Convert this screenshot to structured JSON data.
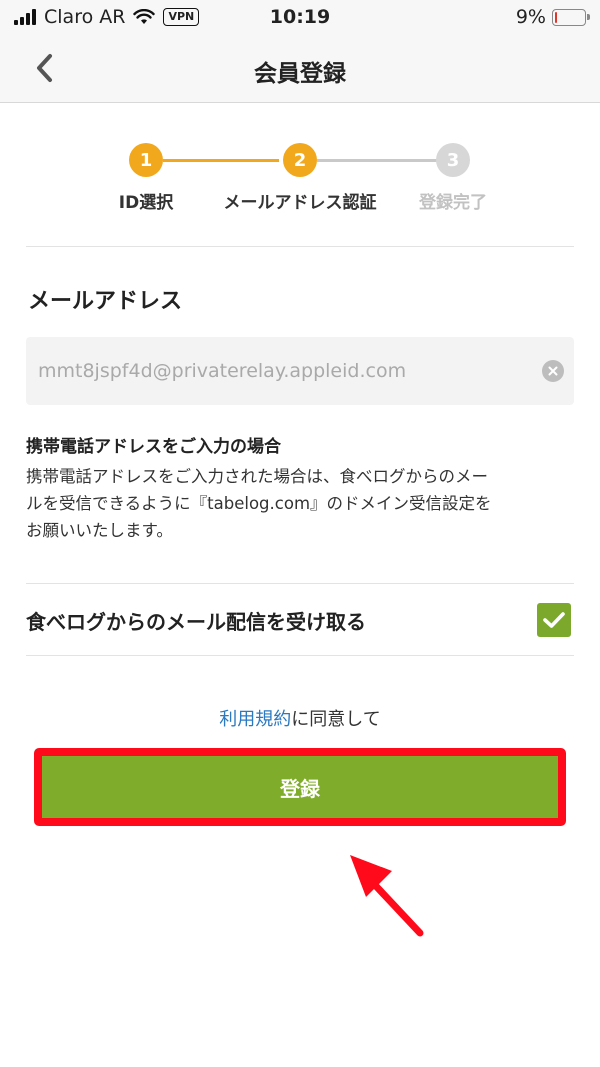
{
  "status_bar": {
    "carrier": "Claro AR",
    "vpn": "VPN",
    "time": "10:19",
    "battery_text": "9%",
    "battery_level": 0.09
  },
  "nav": {
    "title": "会員登録"
  },
  "stepper": {
    "steps": [
      {
        "number": "1",
        "label": "ID選択",
        "state": "done"
      },
      {
        "number": "2",
        "label": "メールアドレス認証",
        "state": "current"
      },
      {
        "number": "3",
        "label": "登録完了",
        "state": "pending"
      }
    ]
  },
  "email": {
    "label": "メールアドレス",
    "value": "mmt8jspf4d@privaterelay.appleid.com"
  },
  "mobile_note": {
    "title": "携帯電話アドレスをご入力の場合",
    "lines": [
      "携帯電話アドレスをご入力された場合は、食べログからのメー",
      "ルを受信できるように『tabelog.com』のドメイン受信設定を",
      "お願いいたします。"
    ]
  },
  "receive_mail": {
    "label": "食べログからのメール配信を受け取る",
    "checked": true
  },
  "agreement": {
    "terms_link": "利用規約",
    "suffix": "に同意して"
  },
  "register_button": {
    "label": "登録"
  },
  "colors": {
    "accent_orange": "#f2a81d",
    "inactive_gray": "#c9c9c9",
    "brand_green": "#7fac2a",
    "link_blue": "#2b79c0",
    "highlight_red": "#ff0a1a"
  }
}
